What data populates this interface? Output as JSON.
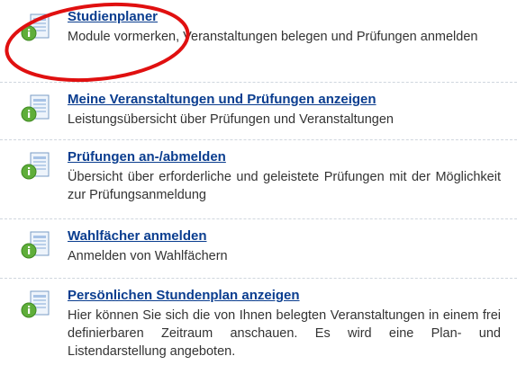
{
  "items": [
    {
      "title": "Studienplaner",
      "description": "Module vormerken, Veranstaltungen belegen und Prüfungen anmelden",
      "icon": "document-info-icon"
    },
    {
      "title": "Meine Veranstaltungen und Prüfungen anzeigen",
      "description": "Leistungsübersicht über Prüfungen und Veranstaltungen",
      "icon": "document-info-icon"
    },
    {
      "title": "Prüfungen an-/abmelden",
      "description": "Übersicht über erforderliche und geleistete Prüfungen mit der Möglichkeit zur Prüfungsanmeldung",
      "icon": "document-info-icon"
    },
    {
      "title": "Wahlfächer anmelden",
      "description": "Anmelden von Wahlfächern",
      "icon": "document-info-icon"
    },
    {
      "title": "Persönlichen Stundenplan anzeigen",
      "description": "Hier können Sie sich die von Ihnen belegten Veranstaltungen in einem frei definierbaren Zeitraum anschauen. Es wird eine Plan- und Listendarstellung angeboten.",
      "icon": "document-info-icon"
    }
  ],
  "colors": {
    "link": "#0a3d8f",
    "text": "#333333",
    "highlight": "#e01010",
    "separator": "#cfd6de"
  }
}
